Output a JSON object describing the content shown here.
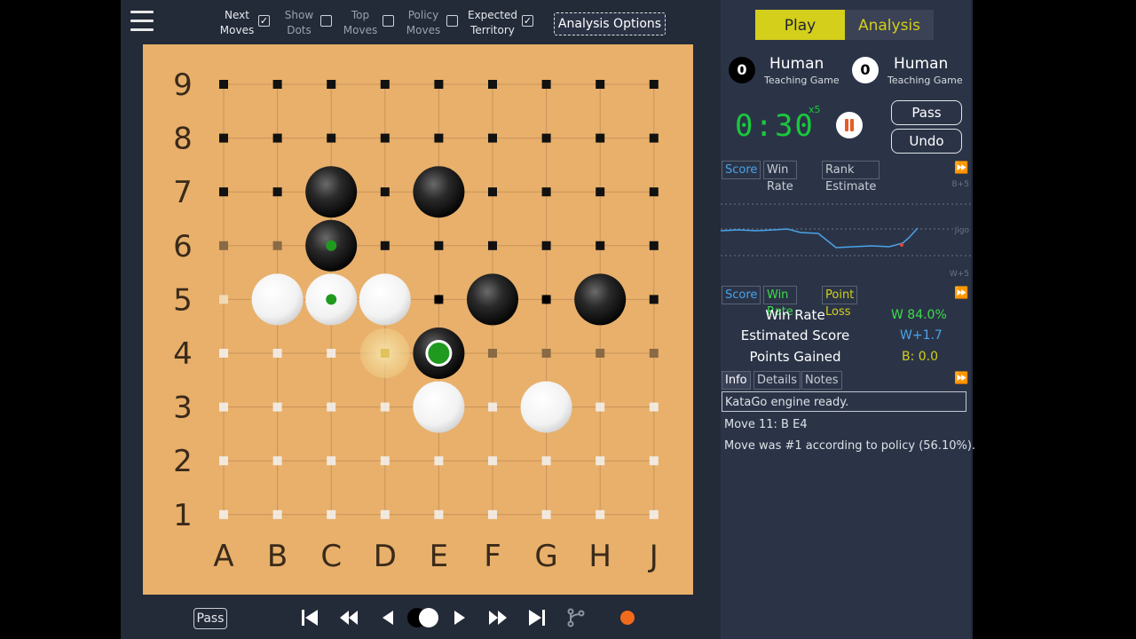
{
  "options": {
    "next_moves": "Next\nMoves",
    "show_dots": "Show\nDots",
    "top_moves": "Top\nMoves",
    "policy_moves": "Policy\nMoves",
    "expected_territory": "Expected\nTerritory",
    "checked": "✓",
    "analysis_options": "Analysis Options"
  },
  "board": {
    "row_labels": [
      "9",
      "8",
      "7",
      "6",
      "5",
      "4",
      "3",
      "2",
      "1"
    ],
    "col_labels": [
      "A",
      "B",
      "C",
      "D",
      "E",
      "F",
      "G",
      "H",
      "J"
    ],
    "black_stones": [
      "C7",
      "E7",
      "C6",
      "F5",
      "H5",
      "E4"
    ],
    "white_stones": [
      "B5",
      "C5",
      "D5",
      "E3",
      "G3"
    ],
    "last_move": "E4",
    "hint_move": "D4"
  },
  "bottom": {
    "pass_label": "Pass"
  },
  "mode_tabs": {
    "play": "Play",
    "analysis": "Analysis"
  },
  "players": {
    "black": {
      "captures": "0",
      "name": "Human",
      "type": "Teaching Game"
    },
    "white": {
      "captures": "0",
      "name": "Human",
      "type": "Teaching Game"
    }
  },
  "clock": {
    "time": "0:30",
    "periods": "x5"
  },
  "controls": {
    "pass": "Pass",
    "undo": "Undo"
  },
  "graph_tabs": {
    "score": "Score",
    "win_rate": "Win Rate",
    "rank_estimate": "Rank Estimate"
  },
  "graph": {
    "top_label": "B+5",
    "mid_label": "Jigo",
    "bottom_label": "W+5"
  },
  "stats_tabs": {
    "score": "Score",
    "win_rate": "Win Rate",
    "point_loss": "Point Loss"
  },
  "stats": {
    "win_rate_label": "Win Rate",
    "win_rate_value": "W 84.0%",
    "score_label": "Estimated Score",
    "score_value": "W+1.7",
    "points_label": "Points Gained",
    "points_value": "B: 0.0"
  },
  "info_tabs": {
    "info": "Info",
    "details": "Details",
    "notes": "Notes"
  },
  "info": {
    "status": "KataGo engine ready.",
    "move": "Move 11: B E4",
    "policy": "Move was #1 according to policy  (56.10%)."
  },
  "colors": {
    "board": "#e8b06b",
    "accent_yellow": "#d3cf1a",
    "clock_green": "#18c93c",
    "win_rate_green": "#3ddc4a",
    "score_blue": "#4aa3e8"
  }
}
